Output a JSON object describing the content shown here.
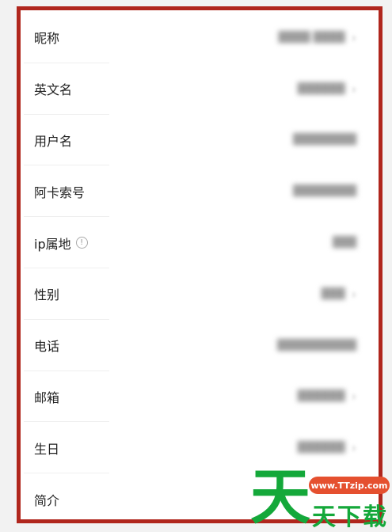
{
  "profile": {
    "rows": [
      {
        "label": "昵称",
        "value": "████ ████",
        "chevron": true
      },
      {
        "label": "英文名",
        "value": "██████",
        "chevron": true
      },
      {
        "label": "用户名",
        "value": "████████",
        "chevron": false
      },
      {
        "label": "阿卡索号",
        "value": "████████",
        "chevron": false
      },
      {
        "label": "ip属地",
        "value": "███",
        "chevron": false
      },
      {
        "label": "性别",
        "value": "███",
        "chevron": true
      },
      {
        "label": "电话",
        "value": "██████████",
        "chevron": false
      },
      {
        "label": "邮箱",
        "value": "██████",
        "chevron": true
      },
      {
        "label": "生日",
        "value": "██████",
        "chevron": true
      },
      {
        "label": "简介",
        "value": "",
        "chevron": false
      }
    ],
    "info_icon": "info-icon",
    "chevron_icon": "chevron-right-icon"
  },
  "watermark": {
    "glyph": "天",
    "url": "www.TTzip.com",
    "name": "天下载"
  },
  "colors": {
    "frame_border": "#b0261d",
    "watermark_green": "#14a83a",
    "watermark_badge": "#e5502f"
  }
}
